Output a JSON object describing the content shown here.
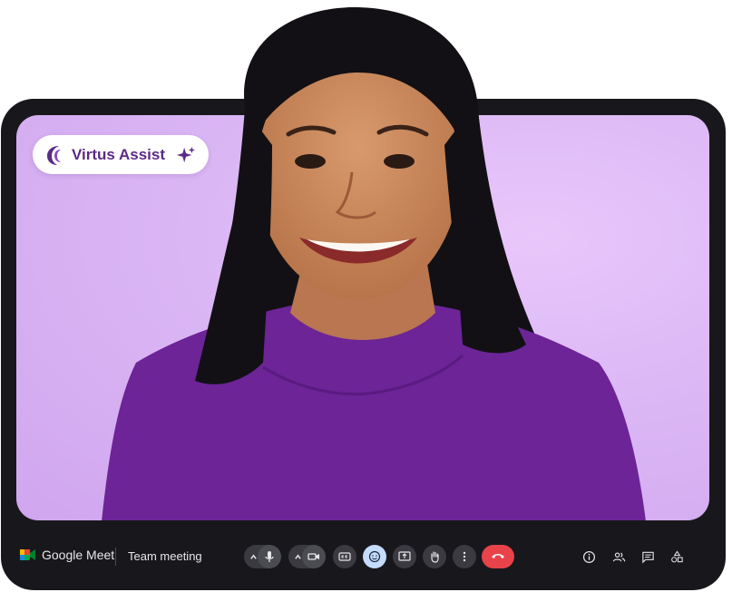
{
  "assistant": {
    "name": "Virtus Assist",
    "brand_color": "#5b2a86"
  },
  "meet": {
    "app_name": "Google Meet",
    "meeting_title": "Team meeting"
  },
  "controls": {
    "mic_icon": "microphone-icon",
    "camera_icon": "video-camera-icon",
    "captions_icon": "closed-captions-icon",
    "reactions_icon": "smile-icon",
    "present_icon": "present-screen-icon",
    "raise_hand_icon": "hand-icon",
    "more_icon": "more-vertical-icon",
    "end_call_icon": "end-call-icon",
    "end_call_color": "#e8434a"
  },
  "right_tools": [
    "info-icon",
    "people-icon",
    "chat-icon",
    "activities-icon"
  ]
}
